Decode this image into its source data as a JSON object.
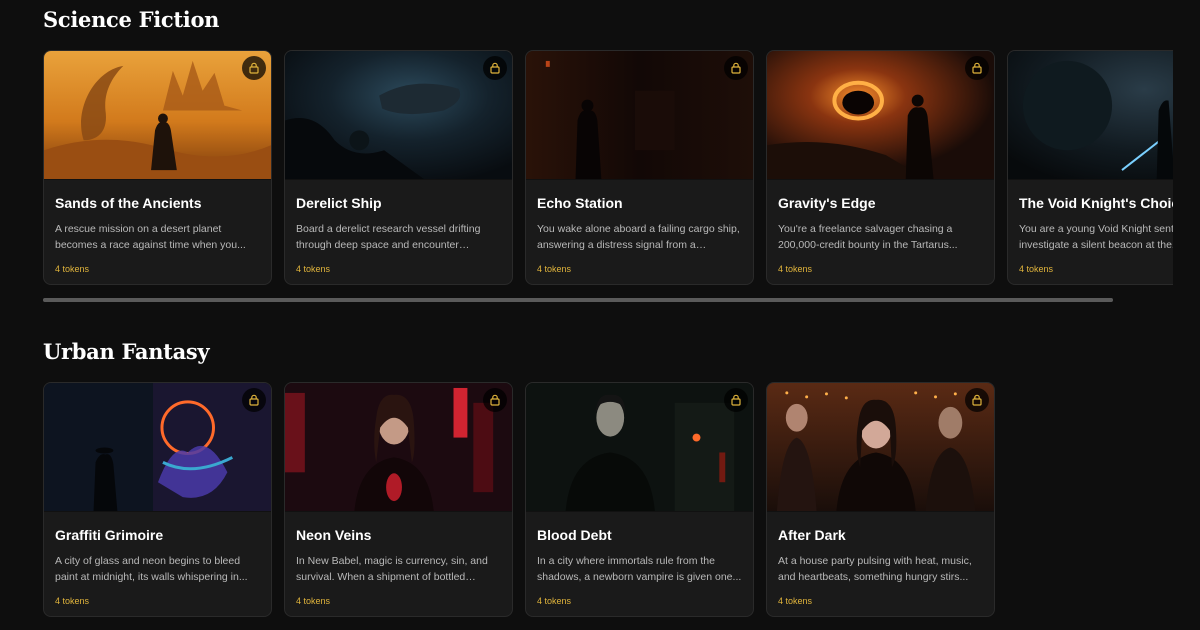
{
  "sections": [
    {
      "title": "Science Fiction",
      "cards": [
        {
          "title": "Sands of the Ancients",
          "description": "A rescue mission on a desert planet becomes a race against time when you...",
          "tokens": "4 tokens"
        },
        {
          "title": "Derelict Ship",
          "description": "Board a derelict research vessel drifting through deep space and encounter ARGO-...",
          "tokens": "4 tokens"
        },
        {
          "title": "Echo Station",
          "description": "You wake alone aboard a failing cargo ship, answering a distress signal from a researc...",
          "tokens": "4 tokens"
        },
        {
          "title": "Gravity's Edge",
          "description": "You're a freelance salvager chasing a 200,000-credit bounty in the Tartarus...",
          "tokens": "4 tokens"
        },
        {
          "title": "The Void Knight's Choice",
          "description": "You are a young Void Knight sent to investigate a silent beacon at the...",
          "tokens": "4 tokens"
        }
      ]
    },
    {
      "title": "Urban Fantasy",
      "cards": [
        {
          "title": "Graffiti Grimoire",
          "description": "A city of glass and neon begins to bleed paint at midnight, its walls whispering in...",
          "tokens": "4 tokens"
        },
        {
          "title": "Neon Veins",
          "description": "In New Babel, magic is currency, sin, and survival. When a shipment of bottled huma...",
          "tokens": "4 tokens"
        },
        {
          "title": "Blood Debt",
          "description": "In a city where immortals rule from the shadows, a newborn vampire is given one...",
          "tokens": "4 tokens"
        },
        {
          "title": "After Dark",
          "description": "At a house party pulsing with heat, music, and heartbeats, something hungry stirs...",
          "tokens": "4 tokens"
        }
      ]
    }
  ],
  "icons": {
    "lock": "lock-icon"
  },
  "colors": {
    "background": "#0e0e0e",
    "card": "#1a1a1a",
    "tokens": "#e0b43c"
  }
}
